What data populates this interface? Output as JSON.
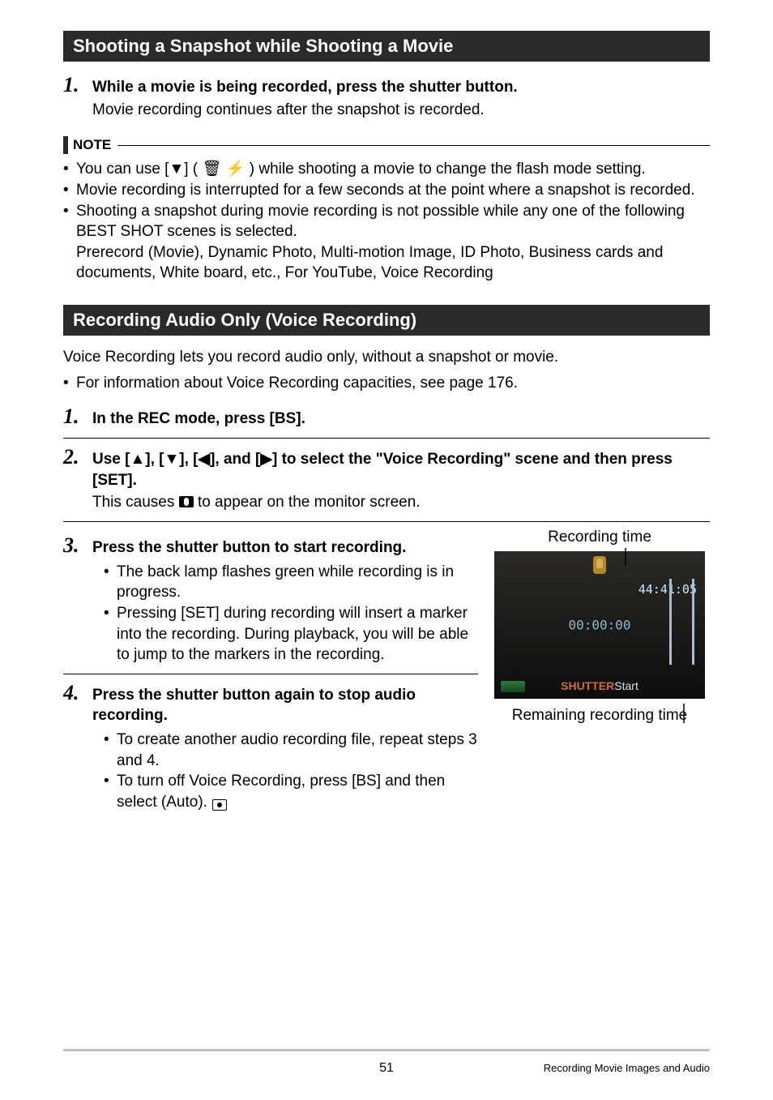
{
  "section1": {
    "title": "Shooting a Snapshot while Shooting a Movie"
  },
  "step1": {
    "num": "1.",
    "title": "While a movie is being recorded, press the shutter button.",
    "text": "Movie recording continues after the snapshot is recorded."
  },
  "note": {
    "label": "NOTE",
    "items": [
      "You can use [▼] ( 🗑 ⚡ ) while shooting a movie to change the flash mode setting.",
      "Movie recording is interrupted for a few seconds at the point where a snapshot is recorded.",
      "Shooting a snapshot during movie recording is not possible while any one of the following BEST SHOT scenes is selected."
    ],
    "extra": "Prerecord (Movie), Dynamic Photo, Multi-motion Image, ID Photo, Business cards and documents, White board, etc., For YouTube, Voice Recording"
  },
  "section2": {
    "title": "Recording Audio Only (Voice Recording)"
  },
  "intro": {
    "text": "Voice Recording lets you record audio only, without a snapshot or movie.",
    "bullet": "For information about Voice Recording capacities, see page 176."
  },
  "stepA": {
    "num": "1.",
    "title": "In the REC mode, press [BS]."
  },
  "stepB": {
    "num": "2.",
    "title": "Use [▲], [▼], [◀], and [▶] to select the \"Voice Recording\" scene and then press [SET].",
    "text_pre": "This causes ",
    "text_post": " to appear on the monitor screen."
  },
  "stepC": {
    "num": "3.",
    "title": "Press the shutter button to start recording.",
    "bullets": [
      "The back lamp flashes green while recording is in progress.",
      "Pressing [SET] during recording will insert a marker into the recording. During playback, you will be able to jump to the markers in the recording."
    ]
  },
  "stepD": {
    "num": "4.",
    "title": "Press the shutter button again to stop audio recording.",
    "bullets": [
      "To create another audio recording file, repeat steps 3 and 4.",
      "To turn off Voice Recording, press [BS] and then select      (Auto)."
    ]
  },
  "screen": {
    "top_label": "Recording time",
    "remaining": "44:41:05",
    "elapsed": "00:00:00",
    "shutter": "SHUTTER",
    "start": "Start",
    "bottom_label": "Remaining recording time"
  },
  "footer": {
    "page": "51",
    "section": "Recording Movie Images and Audio"
  }
}
